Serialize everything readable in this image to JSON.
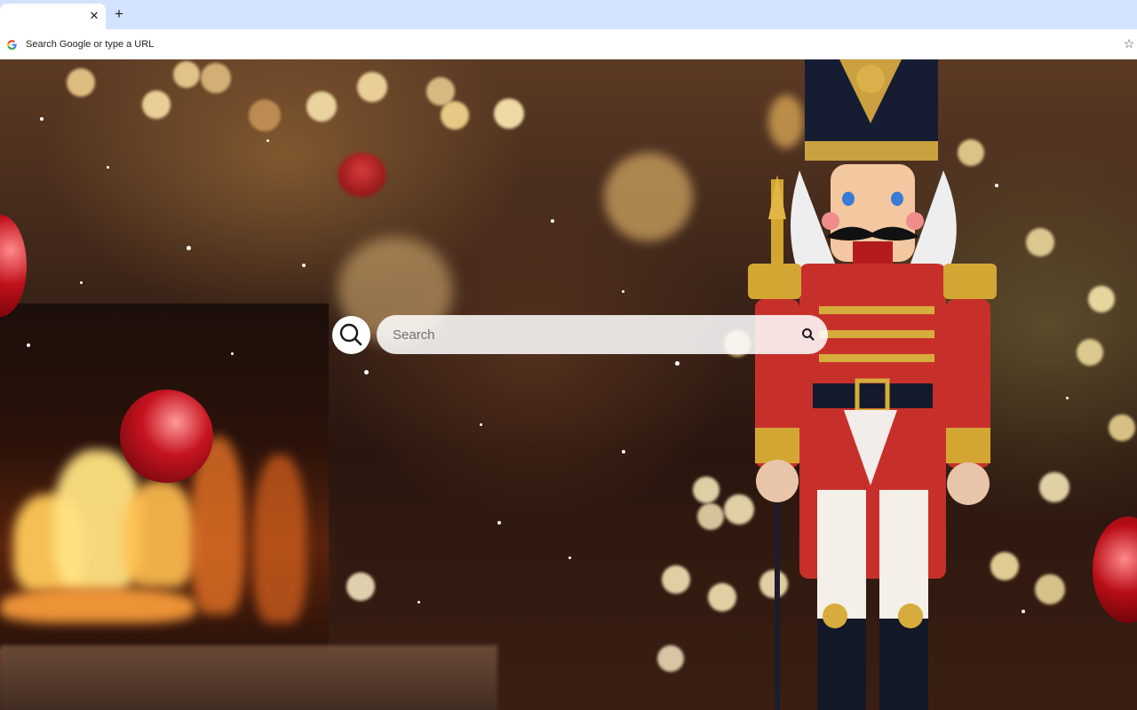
{
  "tabs": [
    {
      "title": "",
      "close_label": "✕",
      "active": true
    }
  ],
  "new_tab_label": "+",
  "omnibox": {
    "text": "Search Google or type a URL"
  },
  "page": {
    "search_placeholder": "Search"
  },
  "icons": {
    "omnibox_leading": "google-g-icon",
    "bookmark": "star-icon",
    "search_button": "search-icon",
    "search_box_trailing": "search-icon"
  },
  "colors": {
    "tabstrip": "#d3e3fd",
    "toolbar": "#ffffff",
    "search_box": "#ffffff"
  }
}
